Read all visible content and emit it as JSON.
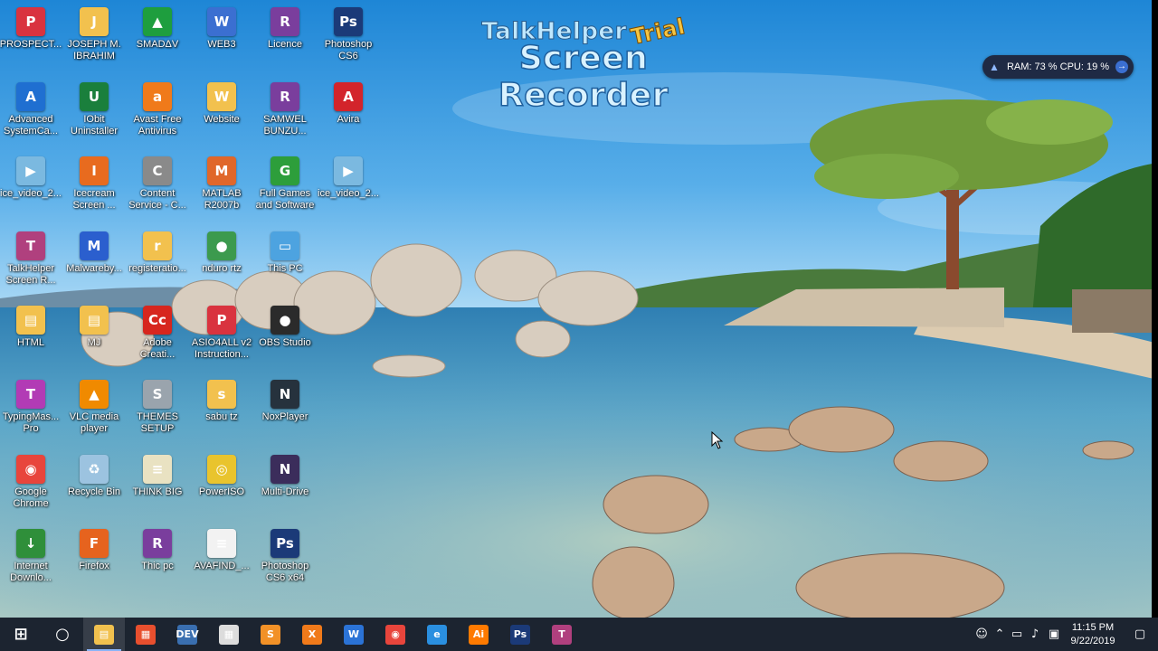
{
  "desktop": {
    "icons": [
      {
        "label": "PROSPECT...",
        "icon": "pdf-document-icon",
        "color": "#d9333f",
        "glyph": "P"
      },
      {
        "label": "JOSEPH M.\nIBRAHIM",
        "icon": "folder-file-icon",
        "color": "#f2c14e",
        "glyph": "J"
      },
      {
        "label": "SMADΔV",
        "icon": "smadav-antivirus-icon",
        "color": "#1e9e3e",
        "glyph": "▲"
      },
      {
        "label": "WEB3",
        "icon": "web3-app-icon",
        "color": "#3b6fd1",
        "glyph": "W"
      },
      {
        "label": "Licence",
        "icon": "winrar-archive-icon",
        "color": "#7a3e9d",
        "glyph": "R"
      },
      {
        "label": "Photoshop\nCS6",
        "icon": "photoshop-icon",
        "color": "#1b3a78",
        "glyph": "Ps"
      },
      {
        "label": "Advanced\nSystemCa...",
        "icon": "advanced-systemcare-icon",
        "color": "#1f6fd1",
        "glyph": "A"
      },
      {
        "label": "IObit\nUninstaller",
        "icon": "iobit-uninstaller-icon",
        "color": "#1a7f3c",
        "glyph": "U"
      },
      {
        "label": "Avast Free\nAntivirus",
        "icon": "avast-antivirus-icon",
        "color": "#f07a1a",
        "glyph": "a"
      },
      {
        "label": "Website",
        "icon": "folder-file-icon",
        "color": "#f2c14e",
        "glyph": "W"
      },
      {
        "label": "SAMWEL\nBUNZU...",
        "icon": "winrar-archive-icon",
        "color": "#7a3e9d",
        "glyph": "R"
      },
      {
        "label": "Avira",
        "icon": "avira-antivirus-icon",
        "color": "#d3242b",
        "glyph": "A"
      },
      {
        "label": "ice_video_2...",
        "icon": "video-file-icon",
        "color": "#7bb9e0",
        "glyph": "▶"
      },
      {
        "label": "Icecream\nScreen ...",
        "icon": "icecream-screen-recorder-icon",
        "color": "#e86b1f",
        "glyph": "I"
      },
      {
        "label": "Content\nService - C...",
        "icon": "content-service-icon",
        "color": "#8a8a8a",
        "glyph": "C"
      },
      {
        "label": "MATLAB\nR2007b",
        "icon": "matlab-icon",
        "color": "#e0672a",
        "glyph": "M"
      },
      {
        "label": "Full Games\nand Software",
        "icon": "games-software-icon",
        "color": "#2d9e3b",
        "glyph": "G"
      },
      {
        "label": "ice_video_2...",
        "icon": "video-file-icon",
        "color": "#7bb9e0",
        "glyph": "▶"
      },
      {
        "label": "TalkHelper\nScreen R...",
        "icon": "talkhelper-icon",
        "color": "#b0407e",
        "glyph": "T"
      },
      {
        "label": "Malwareby...",
        "icon": "malwarebytes-icon",
        "color": "#2b5fce",
        "glyph": "M"
      },
      {
        "label": "registeratio...",
        "icon": "folder-file-icon",
        "color": "#f2c14e",
        "glyph": "r"
      },
      {
        "label": "nduro rtz",
        "icon": "globe-icon",
        "color": "#3c9a4e",
        "glyph": "●"
      },
      {
        "label": "This PC",
        "icon": "this-pc-icon",
        "color": "#4da3e0",
        "glyph": "▭"
      },
      {
        "label": "HTML",
        "icon": "folder-icon",
        "color": "#f2c14e",
        "glyph": "▤"
      },
      {
        "label": "MJ",
        "icon": "folder-icon",
        "color": "#f2c14e",
        "glyph": "▤"
      },
      {
        "label": "Adobe\nCreati...",
        "icon": "adobe-creative-cloud-icon",
        "color": "#d7261e",
        "glyph": "Cc"
      },
      {
        "label": "ASIO4ALL v2\nInstruction...",
        "icon": "pdf-document-icon",
        "color": "#d9333f",
        "glyph": "P"
      },
      {
        "label": "OBS Studio",
        "icon": "obs-studio-icon",
        "color": "#2b2b2b",
        "glyph": "●"
      },
      {
        "label": "TypingMas...\nPro",
        "icon": "typingmaster-icon",
        "color": "#b23bb5",
        "glyph": "T"
      },
      {
        "label": "VLC media\nplayer",
        "icon": "vlc-player-icon",
        "color": "#f08a00",
        "glyph": "▲"
      },
      {
        "label": "THEMES\nSETUP",
        "icon": "setup-installer-icon",
        "color": "#9aa4ad",
        "glyph": "S"
      },
      {
        "label": "sabu tz",
        "icon": "folder-file-icon",
        "color": "#f2c14e",
        "glyph": "s"
      },
      {
        "label": "NoxPlayer",
        "icon": "noxplayer-icon",
        "color": "#26323d",
        "glyph": "N"
      },
      {
        "label": "Google\nChrome",
        "icon": "chrome-icon",
        "color": "#e8453c",
        "glyph": "◉"
      },
      {
        "label": "Recycle Bin",
        "icon": "recycle-bin-icon",
        "color": "#9cc3e0",
        "glyph": "♻"
      },
      {
        "label": "THINK BIG",
        "icon": "document-icon",
        "color": "#e9e2c2",
        "glyph": "≡"
      },
      {
        "label": "PowerISO",
        "icon": "poweriso-icon",
        "color": "#e9c42d",
        "glyph": "◎"
      },
      {
        "label": "Multi-Drive",
        "icon": "multi-drive-icon",
        "color": "#3b2d5b",
        "glyph": "N"
      },
      {
        "label": "Internet\nDownlo...",
        "icon": "internet-download-manager-icon",
        "color": "#2f8f3a",
        "glyph": "↓"
      },
      {
        "label": "Firefox",
        "icon": "firefox-icon",
        "color": "#e6631e",
        "glyph": "F"
      },
      {
        "label": "Thic pc",
        "icon": "winrar-archive-icon",
        "color": "#7a3e9d",
        "glyph": "R"
      },
      {
        "label": "AVAFIND_...",
        "icon": "document-icon",
        "color": "#f2f2f2",
        "glyph": "≡"
      },
      {
        "label": "Photoshop\nCS6 x64",
        "icon": "photoshop-icon",
        "color": "#1b3a78",
        "glyph": "Ps"
      }
    ]
  },
  "watermark": {
    "line1": "TalkHelper",
    "trial": "Trial",
    "line2": "Screen Recorder"
  },
  "system_monitor": {
    "ram_label": "RAM:",
    "ram_value": "73 %",
    "cpu_label": "CPU:",
    "cpu_value": "19 %"
  },
  "taskbar": {
    "apps": [
      {
        "name": "start",
        "icon": "windows-start-icon",
        "color": "#ffffff",
        "glyph": "⊞"
      },
      {
        "name": "cortana",
        "icon": "cortana-search-icon",
        "color": "#ffffff",
        "glyph": "○"
      },
      {
        "name": "file-explorer",
        "icon": "file-explorer-icon",
        "color": "#f2c14e",
        "glyph": "▤",
        "active": true
      },
      {
        "name": "store",
        "icon": "store-icon",
        "color": "#e84f2e",
        "glyph": "▦"
      },
      {
        "name": "dev",
        "icon": "dev-tool-icon",
        "color": "#3a6fb0",
        "glyph": "DEV"
      },
      {
        "name": "calendar",
        "icon": "calendar-icon",
        "color": "#dcdcdc",
        "glyph": "▦"
      },
      {
        "name": "sublime",
        "icon": "sublime-text-icon",
        "color": "#f29127",
        "glyph": "S"
      },
      {
        "name": "xampp",
        "icon": "xampp-icon",
        "color": "#f07a1a",
        "glyph": "X"
      },
      {
        "name": "word",
        "icon": "word-icon",
        "color": "#2b73d6",
        "glyph": "W"
      },
      {
        "name": "chrome",
        "icon": "chrome-icon",
        "color": "#e8453c",
        "glyph": "◉"
      },
      {
        "name": "edge",
        "icon": "internet-explorer-icon",
        "color": "#2a8fe0",
        "glyph": "e"
      },
      {
        "name": "illustrator",
        "icon": "illustrator-icon",
        "color": "#ff7a00",
        "glyph": "Ai"
      },
      {
        "name": "photoshop",
        "icon": "photoshop-icon",
        "color": "#1b3a78",
        "glyph": "Ps"
      },
      {
        "name": "talkhelper",
        "icon": "talkhelper-icon",
        "color": "#b0407e",
        "glyph": "T"
      }
    ],
    "tray": {
      "time": "11:15 PM",
      "date": "9/22/2019"
    }
  }
}
